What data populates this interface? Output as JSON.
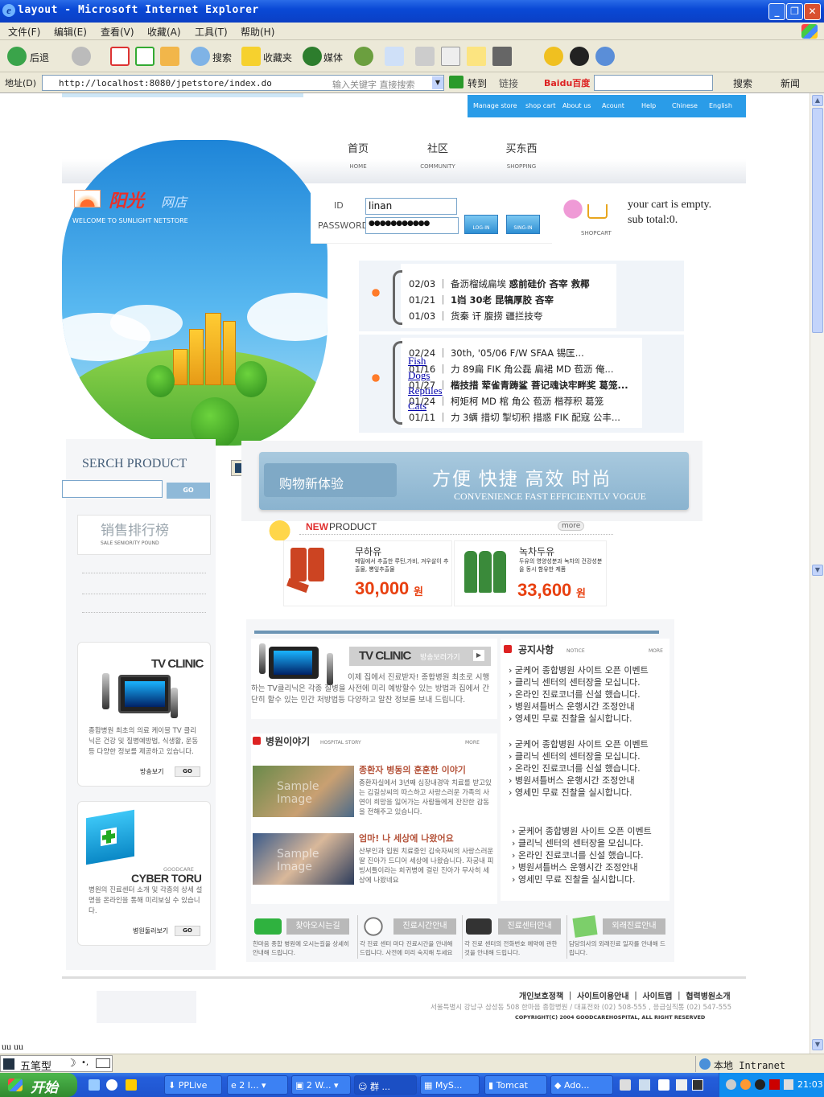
{
  "window": {
    "title": "layout - Microsoft Internet Explorer"
  },
  "menu": [
    "文件(F)",
    "编辑(E)",
    "查看(V)",
    "收藏(A)",
    "工具(T)",
    "帮助(H)"
  ],
  "toolbar": {
    "back": "后退",
    "search": "搜索",
    "favorites": "收藏夹",
    "media": "媒体"
  },
  "address": {
    "label": "地址(D)",
    "url": "http://localhost:8080/jpetstore/index.do",
    "keyword_hint": "输入关键字 直接搜索",
    "go": "转到",
    "links": "链接",
    "baidu_logo": "Baidu百度",
    "baidu_search": "搜索",
    "news": "新闻"
  },
  "page": {
    "topnav": [
      "Manage store",
      "shop cart",
      "About us",
      "Acount",
      "Help",
      "Chinese",
      "English"
    ],
    "mainnav": [
      {
        "cn": "首页",
        "en": "HOME"
      },
      {
        "cn": "社区",
        "en": "COMMUNITY"
      },
      {
        "cn": "买东西",
        "en": "SHOPPING"
      }
    ],
    "logo": {
      "name": "阳光",
      "sub": "网店",
      "welcome": "WELCOME TO SUNLIGHT NETSTORE"
    },
    "login": {
      "id_label": "ID",
      "pw_label": "PASSWORD",
      "id_value": "linan",
      "pw_value": "●●●●●●●●●●●",
      "login_btn": "LOG-IN",
      "signin_btn": "SING-IN"
    },
    "cart": {
      "label": "SHOPCART",
      "line1": "your cart is empty.",
      "line2": "sub total:0."
    },
    "news1": [
      {
        "date": "02/03",
        "text": "备沥榴绒扁埃",
        "bold": "惑前硅价 吝宰 救椰"
      },
      {
        "date": "01/21",
        "text": "",
        "bold": "1岿 30老 昆犒厚胶 吝宰"
      },
      {
        "date": "01/03",
        "text": "货秦 讦 腹捞 疆拦技夸",
        "bold": ""
      }
    ],
    "news2": [
      {
        "date": "02/24",
        "text": "30th, '05/06 F/W SFAA 锡匡..."
      },
      {
        "date": "01/16",
        "text": "力 89扁 FIK 角公磊 扁裙 MD 苞沥 俺..."
      },
      {
        "date": "01/27",
        "text": "",
        "bold": "楷技措 荤雀青踌鲨 菩记魂诀牢畔奖 葛笼..."
      },
      {
        "date": "01/24",
        "text": "柯矩柯 MD 棺 角公 苞沥 楷荐积 葛笼"
      },
      {
        "date": "01/11",
        "text": "力 3螨 措切 掣切积 措惑 FIK 配寇 公丰..."
      }
    ],
    "categories": [
      "Fish",
      "Dogs",
      "Reptiles",
      "Cats"
    ],
    "search": {
      "title": "SERCH PRODUCT",
      "go": "GO"
    },
    "rank": {
      "title": "销售排行榜",
      "sub": "SALE SENIORITY POUND"
    },
    "banner": {
      "left": "购物新体验",
      "cn": "方便 快捷 高效 时尚",
      "en": "CONVENIENCE FAST EFFICIENTLV VOGUE"
    },
    "newproduct": {
      "new": "NEW",
      "product": "PRODUCT",
      "more": "more",
      "items": [
        {
          "name": "무하유",
          "desc": "메밀에서 추출한 루틴,가비, 겨우살이 추출물, 뽕잎추출물",
          "price": "30,000",
          "unit": "원"
        },
        {
          "name": "녹차두유",
          "desc": "두유의 영양성분과 녹차의 건강성분을 동시 함유한 제품",
          "price": "33,600",
          "unit": "원"
        }
      ]
    },
    "tvclinic": {
      "title": "TV CLINIC",
      "sub": "방송보러가기",
      "desc": "이제 집에서 진료받자! 종합병원 최초로 시행하는 TV클리닉은 각종 질병을 사전에 미리 예방할수 있는 방법과 집에서 간단히 할수 있는 민간 처방법등 다양하고 알찬 정보를 보내 드립니다.",
      "side_desc": "종합병원 최초의 의료 케이블 TV 클리닉은 건강 및 질병예방법, 식생활, 운동 등 다양한 정보를 제공하고 있습니다.",
      "side_link": "방송보기",
      "go": "GO"
    },
    "notice": {
      "title": "공지사항",
      "tag": "NOTICE",
      "more": "MORE",
      "items": [
        "굳케어 종합병원 사이트 오픈 이벤트",
        "클리닉 센터의 센터장을 모십니다.",
        "온라인 진료코너를 신설 했습니다.",
        "병원셔틀버스 운행시간 조정안내",
        "영세민 무료 진찰을 실시합니다."
      ]
    },
    "story": {
      "title": "병원이야기",
      "tag": "HOSPITAL STORY",
      "more": "MORE",
      "items": [
        {
          "headline": "종환자 병동의 훈훈한 이야기",
          "body": "종환자실에서 3년째 심장내경막 치료를 받고있는 김길상씨의 따스하고 사랑스러운 가족의 사연이 희망을 잃어가는 사람들에게 잔잔한 감동을 전해주고 있습니다.",
          "img": "Sample Image"
        },
        {
          "headline": "엄마! 나 세상에 나왔어요",
          "body": "산부인과 입원 치료중인 김숙자씨의 사랑스러운 딸 진아가 드디어 세상에 나왔습니다. 자궁내 피빙서틀이라는 희귀병에 걸린 진아가 무사히 세상에 나왔네요",
          "img": "Sample Image"
        }
      ]
    },
    "cyber": {
      "brand": "GOODCARE",
      "title": "CYBER TORU",
      "desc": "병원의 진료센터 소개 및 각층의 상세 설명을 온라인을 통해 미리보실 수 있습니다.",
      "link": "병원둘러보기",
      "go": "GO"
    },
    "services": [
      {
        "title": "찾아오시는길",
        "desc": "한마음 종합 병원에 오시는길을 상세히 안내해 드립니다."
      },
      {
        "title": "진료시간안내",
        "desc": "각 진료 센터 마다 진료시간을 안내해 드립니다. 사전에 미리 숙지해 두세요"
      },
      {
        "title": "진료센터안내",
        "desc": "각 진료 센터의 전화번호 예약에 관한 것을 안내해 드립니다."
      },
      {
        "title": "외래진료안내",
        "desc": "담당의사의 외래진료 일자를 안내해 드립니다."
      }
    ],
    "footer": {
      "links": [
        "개인보호정책",
        "사이트이용안내",
        "사이트맵",
        "협력병원소개"
      ],
      "address": "서울특별시 강남구 삼성동 508 한마음 종합병원 / 대표전화 (02) 508-555 , 응급실직통 (02) 547-555",
      "copyright": "COPYRIGHT(C) 2004 GOODCAREHOSPITAL, ALL RIGHT RESERVED"
    },
    "stray": "uu uu"
  },
  "status": {
    "zone": "本地 Intranet"
  },
  "ime": {
    "name": "五笔型"
  },
  "taskbar": {
    "start": "开始",
    "tasks": [
      "PPLive",
      "2 I...",
      "2 W...",
      "群 ...",
      "MyS...",
      "Tomcat",
      "Ado..."
    ],
    "clock": "21:03"
  }
}
